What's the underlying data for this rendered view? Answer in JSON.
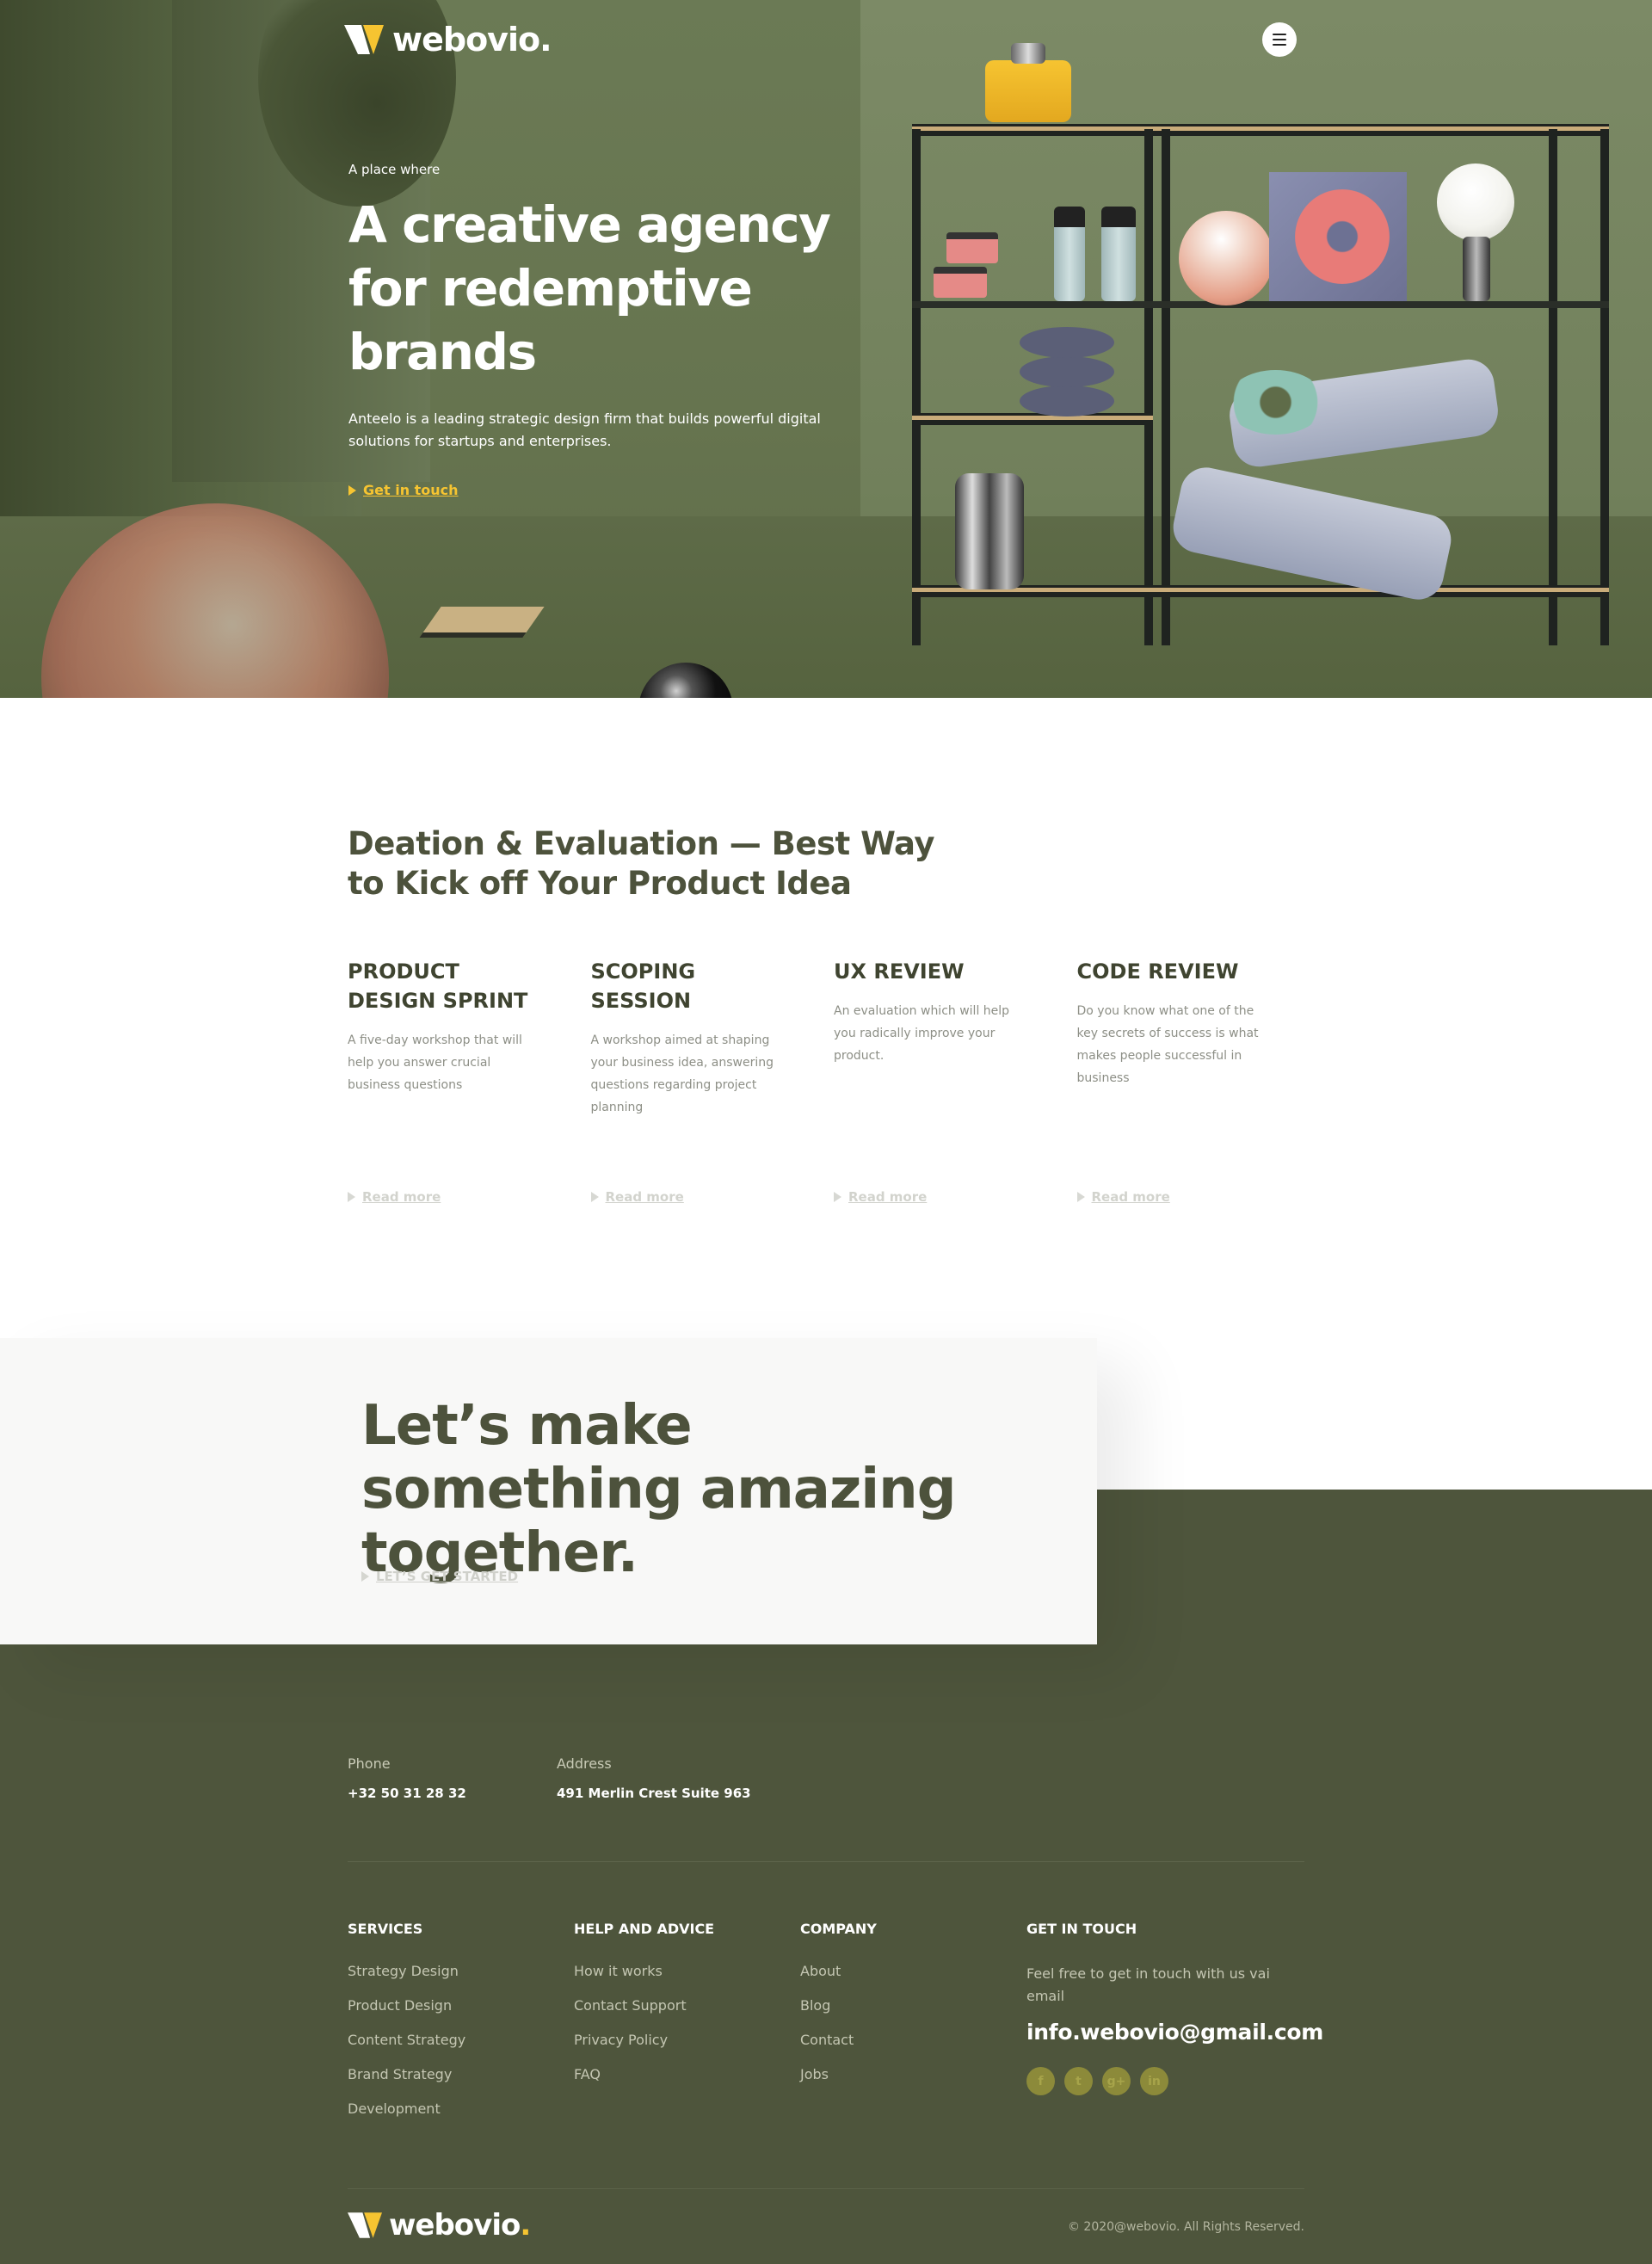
{
  "brand": {
    "name": "webovio",
    "dot": ".",
    "accent_color": "#f6c431",
    "dark_olive": "#4e553c"
  },
  "hero": {
    "eyebrow": "A place where",
    "title": "A creative agency for redemptive brands",
    "description": "Anteelo is a leading strategic design firm that builds powerful digital solutions for startups and enterprises.",
    "cta_label": "Get in touch",
    "menu_icon": "hamburger-icon"
  },
  "services": {
    "title": "Deation & Evaluation — Best Way to Kick off Your Product Idea",
    "items": [
      {
        "title": "PRODUCT DESIGN SPRINT",
        "description": "A five-day workshop that will help you answer crucial business questions",
        "link": "Read more"
      },
      {
        "title": "SCOPING SESSION",
        "description": "A workshop aimed at shaping your business idea, answering questions regarding project planning",
        "link": "Read more"
      },
      {
        "title": "UX REVIEW",
        "description": "An evaluation which will help you radically improve your product.",
        "link": "Read more"
      },
      {
        "title": "CODE REVIEW",
        "description": "Do you know what one of the key secrets of success is what makes people successful in business",
        "link": "Read more"
      }
    ]
  },
  "cta": {
    "title": "Let’s make something amazing together.",
    "link": "LET’S GET STARTED"
  },
  "footer": {
    "contact": [
      {
        "label": "Phone",
        "value": "+32 50 31 28 32"
      },
      {
        "label": "Address",
        "value": "491 Merlin Crest Suite 963"
      }
    ],
    "columns": [
      {
        "title": "SERVICES",
        "items": [
          "Strategy Design",
          "Product Design",
          "Content Strategy",
          "Brand Strategy",
          "Development"
        ]
      },
      {
        "title": "HELP AND ADVICE",
        "items": [
          "How it works",
          "Contact Support",
          "Privacy Policy",
          "FAQ"
        ]
      },
      {
        "title": "COMPANY",
        "items": [
          "About",
          "Blog",
          "Contact",
          "Jobs"
        ]
      }
    ],
    "get_in_touch": {
      "title": "GET IN TOUCH",
      "text": "Feel free to get in touch with us vai email",
      "email": "info.webovio@gmail.com",
      "socials": [
        {
          "icon": "facebook-icon",
          "glyph": "f"
        },
        {
          "icon": "twitter-icon",
          "glyph": "t"
        },
        {
          "icon": "google-plus-icon",
          "glyph": "g+"
        },
        {
          "icon": "linkedin-icon",
          "glyph": "in"
        }
      ]
    },
    "copyright": "© 2020@webovio. All Rights Reserved."
  }
}
